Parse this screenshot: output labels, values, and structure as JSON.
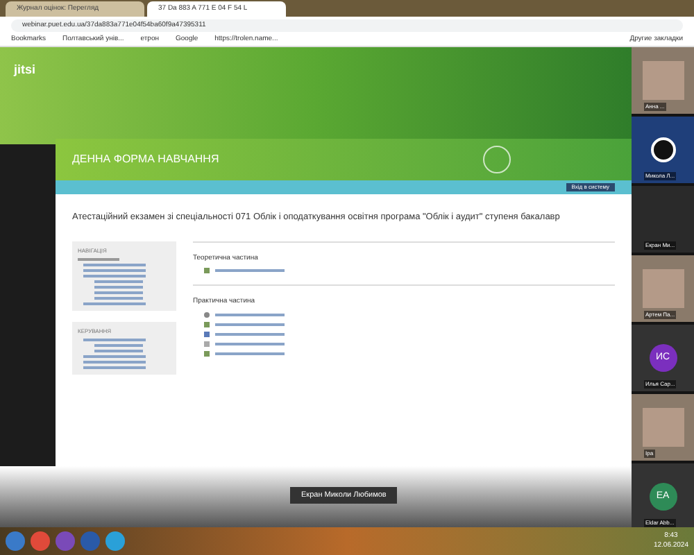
{
  "browser": {
    "tabs": [
      {
        "label": "Журнал оцінок: Перегляд",
        "selected": false
      },
      {
        "label": "37 Da 883 A 771 E 04 F 54 L",
        "selected": true
      }
    ],
    "url": "webinar.puet.edu.ua/37da883a771e04f54ba60f9a47395311",
    "bookmarks": [
      "Bookmarks",
      "Полтавський унів...",
      "етрон",
      "Google",
      "https://trolen.name..."
    ],
    "other_bookmarks": "Другие закладки"
  },
  "meeting": {
    "logo": "jitsi",
    "shared_screen": {
      "banner": "ДЕННА ФОРМА НАВЧАННЯ",
      "login_button": "Вхід в систему",
      "course_title": "Атестаційний екзамен зі спеціальності 071 Облік і оподаткування освітня програма \"Облік і аудит\" ступеня бакалавр",
      "blocks": [
        {
          "title": "НАВІГАЦІЯ",
          "lines": [
            {
              "kind": "top"
            },
            {
              "kind": "nested"
            },
            {
              "kind": "nested"
            },
            {
              "kind": "nested"
            },
            {
              "kind": "deep"
            },
            {
              "kind": "deep"
            },
            {
              "kind": "deep"
            },
            {
              "kind": "deep"
            },
            {
              "kind": "nested"
            }
          ]
        },
        {
          "title": "КЕРУВАННЯ",
          "lines": [
            {
              "kind": "nested"
            },
            {
              "kind": "deep"
            },
            {
              "kind": "deep"
            },
            {
              "kind": "nested"
            },
            {
              "kind": "nested"
            },
            {
              "kind": "nested"
            }
          ]
        }
      ],
      "sections": [
        {
          "title": "Теоретична частина",
          "items": [
            {
              "kind": "quiz"
            }
          ]
        },
        {
          "title": "Практична частина",
          "items": [
            {
              "kind": "test"
            },
            {
              "kind": "quiz"
            },
            {
              "kind": "file"
            },
            {
              "kind": "page"
            },
            {
              "kind": "quiz"
            }
          ]
        }
      ]
    },
    "caption": "Екран Миколи Любимов",
    "participants": [
      {
        "name": "Анна ...",
        "kind": "photo"
      },
      {
        "name": "Микола Л...",
        "kind": "logo"
      },
      {
        "name": "Екран Ми...",
        "kind": "screen"
      },
      {
        "name": "Артем Па...",
        "kind": "photo"
      },
      {
        "name": "Илья Сар...",
        "kind": "avatar",
        "initials": "ИС",
        "color": "#7b2fbe"
      },
      {
        "name": "Іра",
        "kind": "photo"
      },
      {
        "name": "Eldar Abb...",
        "kind": "avatar",
        "initials": "EA",
        "color": "#2e8b57"
      }
    ]
  },
  "taskbar": {
    "time": "8:43",
    "date": "12.06.2024"
  }
}
